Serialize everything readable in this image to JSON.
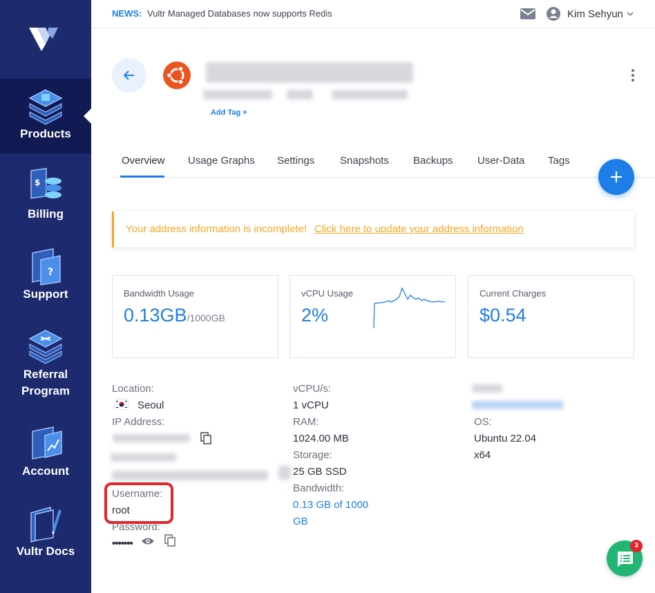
{
  "sidebar": {
    "items": [
      {
        "label": "Products",
        "active": true
      },
      {
        "label": "Billing"
      },
      {
        "label": "Support"
      },
      {
        "label": "Referral Program"
      },
      {
        "label": "Account"
      },
      {
        "label": "Vultr Docs"
      }
    ]
  },
  "topbar": {
    "news_label": "NEWS:",
    "news_text": "Vultr Managed Databases now supports Redis",
    "user_name": "Kim Sehyun"
  },
  "server": {
    "add_tag": "Add Tag +"
  },
  "tabs": [
    "Overview",
    "Usage Graphs",
    "Settings",
    "Snapshots",
    "Backups",
    "User-Data",
    "Tags"
  ],
  "alert": {
    "message": "Your address information is incomplete!",
    "link": "Click here to update your address information",
    "color": "#f5a623"
  },
  "cards": {
    "bandwidth": {
      "label": "Bandwidth Usage",
      "value": "0.13GB",
      "unit": "/1000GB"
    },
    "vcpu": {
      "label": "vCPU Usage",
      "value": "2%"
    },
    "charges": {
      "label": "Current Charges",
      "value": "$0.54"
    }
  },
  "details": {
    "location_label": "Location:",
    "location_value": "Seoul",
    "ip_label": "IP Address:",
    "username_label": "Username:",
    "username_value": "root",
    "password_label": "Password:",
    "password_value": "•••••••",
    "vcpu_label": "vCPU/s:",
    "vcpu_value": "1 vCPU",
    "ram_label": "RAM:",
    "ram_value": "1024.00 MB",
    "storage_label": "Storage:",
    "storage_value": "25 GB SSD",
    "bandwidth_label": "Bandwidth:",
    "bandwidth_value_1": "0.13 GB of 1000",
    "bandwidth_value_2": "GB",
    "os_label": "OS:",
    "os_value": "Ubuntu 22.04",
    "arch_value": "x64"
  },
  "chat": {
    "badge": "3"
  },
  "colors": {
    "accent": "#1e7ee8",
    "sidebar": "#1e2a6e",
    "highlight": "#e3242b",
    "chat": "#22b573"
  }
}
